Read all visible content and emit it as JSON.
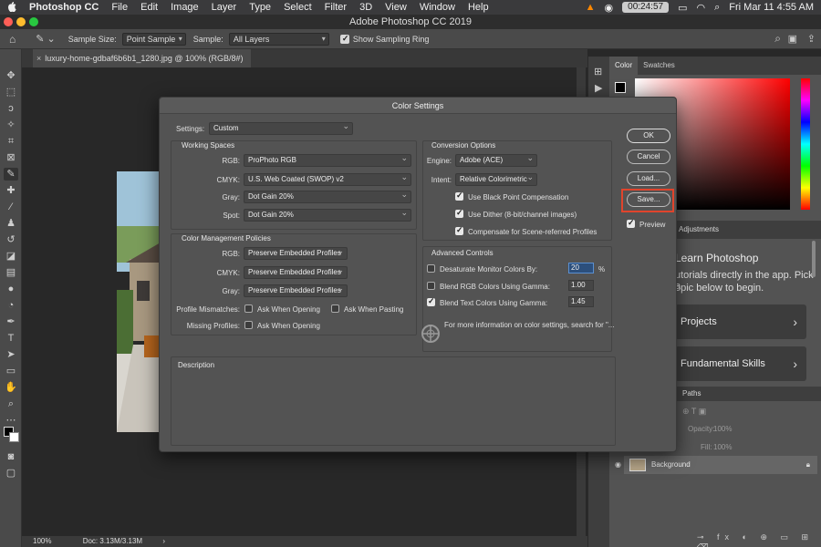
{
  "menubar": {
    "app_name": "Photoshop CC",
    "items": [
      "File",
      "Edit",
      "Image",
      "Layer",
      "Type",
      "Select",
      "Filter",
      "3D",
      "View",
      "Window",
      "Help"
    ],
    "timer": "00:24:57",
    "datetime": "Fri Mar 11  4:55 AM"
  },
  "window": {
    "title": "Adobe Photoshop CC 2019"
  },
  "options": {
    "sample_size_label": "Sample Size:",
    "sample_size_value": "Point Sample",
    "sample_label": "Sample:",
    "sample_value": "All Layers",
    "sampling_ring_label": "Show Sampling Ring",
    "sampling_ring_checked": true
  },
  "document": {
    "tab_title": "luxury-home-gdbaf6b6b1_1280.jpg @ 100% (RGB/8#)",
    "zoom": "100%",
    "doc_info": "Doc: 3.13M/3.13M"
  },
  "color_panel": {
    "tabs": [
      "Color",
      "Swatches"
    ],
    "accent_hue": "#ff0000"
  },
  "learn_panel": {
    "tab": "Adjustments",
    "title": "Learn Photoshop",
    "desc_line1": "utorials directly in the app. Pick a",
    "desc_line2": "opic below to begin.",
    "cards": [
      "Projects",
      "Fundamental Skills"
    ]
  },
  "layers_panel": {
    "tab": "Paths",
    "opacity_label": "Opacity:",
    "opacity_value": "100%",
    "fill_label": "Fill:",
    "fill_value": "100%",
    "layer_name": "Background"
  },
  "dialog": {
    "title": "Color Settings",
    "settings_label": "Settings:",
    "settings_value": "Custom",
    "working_spaces": {
      "title": "Working Spaces",
      "rgb_label": "RGB:",
      "rgb_value": "ProPhoto RGB",
      "cmyk_label": "CMYK:",
      "cmyk_value": "U.S. Web Coated (SWOP) v2",
      "gray_label": "Gray:",
      "gray_value": "Dot Gain 20%",
      "spot_label": "Spot:",
      "spot_value": "Dot Gain 20%"
    },
    "policies": {
      "title": "Color Management Policies",
      "rgb_label": "RGB:",
      "rgb_value": "Preserve Embedded Profiles",
      "cmyk_label": "CMYK:",
      "cmyk_value": "Preserve Embedded Profiles",
      "gray_label": "Gray:",
      "gray_value": "Preserve Embedded Profiles",
      "mismatch_label": "Profile Mismatches:",
      "ask_opening": "Ask When Opening",
      "ask_pasting": "Ask When Pasting",
      "missing_label": "Missing Profiles:",
      "ask_opening2": "Ask When Opening"
    },
    "conversion": {
      "title": "Conversion Options",
      "engine_label": "Engine:",
      "engine_value": "Adobe (ACE)",
      "intent_label": "Intent:",
      "intent_value": "Relative Colorimetric",
      "bpc": "Use Black Point Compensation",
      "dither": "Use Dither (8-bit/channel images)",
      "compensate": "Compensate for Scene-referred Profiles"
    },
    "advanced": {
      "title": "Advanced Controls",
      "desaturate": "Desaturate Monitor Colors By:",
      "desaturate_value": "20",
      "desaturate_unit": "%",
      "blend_rgb": "Blend RGB Colors Using Gamma:",
      "blend_rgb_value": "1.00",
      "blend_text": "Blend Text Colors Using Gamma:",
      "blend_text_value": "1.45",
      "info": "For more information on color settings, search for \"..."
    },
    "description_title": "Description",
    "buttons": {
      "ok": "OK",
      "cancel": "Cancel",
      "load": "Load...",
      "save": "Save..."
    },
    "preview_label": "Preview",
    "highlight_color": "#e0442c"
  }
}
